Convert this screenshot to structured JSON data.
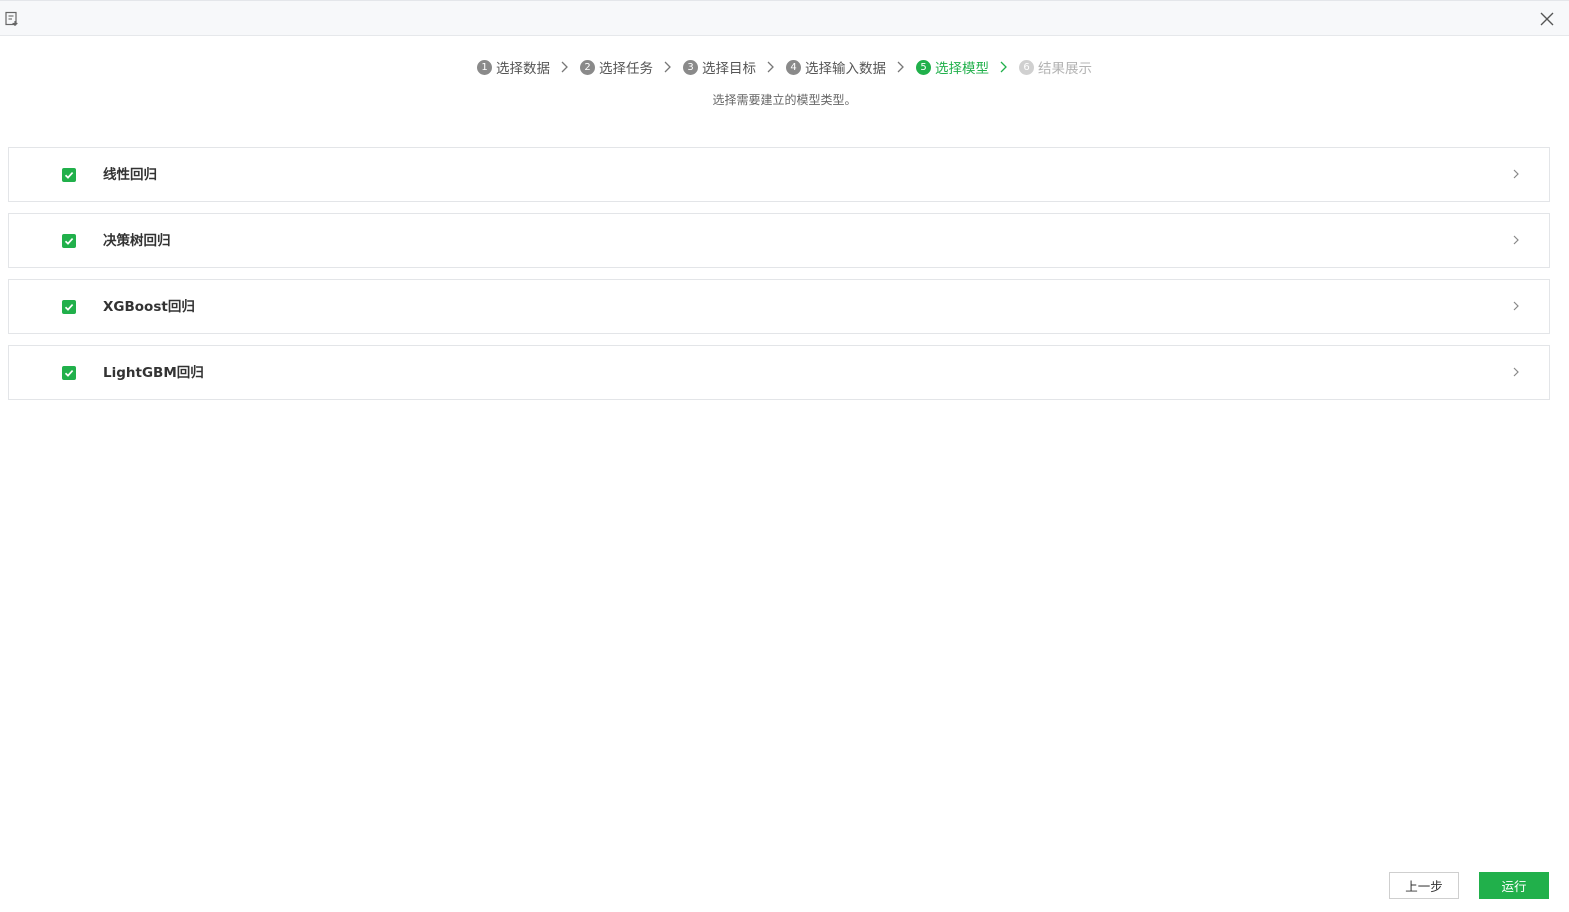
{
  "window": {
    "icons": {
      "left": "document-icon",
      "right": "close-icon"
    }
  },
  "steps": [
    {
      "num": "1",
      "label": "选择数据",
      "state": "done"
    },
    {
      "num": "2",
      "label": "选择任务",
      "state": "done"
    },
    {
      "num": "3",
      "label": "选择目标",
      "state": "done"
    },
    {
      "num": "4",
      "label": "选择输入数据",
      "state": "done"
    },
    {
      "num": "5",
      "label": "选择模型",
      "state": "active"
    },
    {
      "num": "6",
      "label": "结果展示",
      "state": "disabled"
    }
  ],
  "subtitle": "选择需要建立的模型类型。",
  "models": [
    {
      "label": "线性回归",
      "checked": true
    },
    {
      "label": "决策树回归",
      "checked": true
    },
    {
      "label": "XGBoost回归",
      "checked": true
    },
    {
      "label": "LightGBM回归",
      "checked": true
    }
  ],
  "buttons": {
    "prev": "上一步",
    "run": "运行"
  },
  "colors": {
    "accent": "#21b04b",
    "step_default": "#8a8a8a",
    "step_disabled": "#d0d0d0"
  }
}
